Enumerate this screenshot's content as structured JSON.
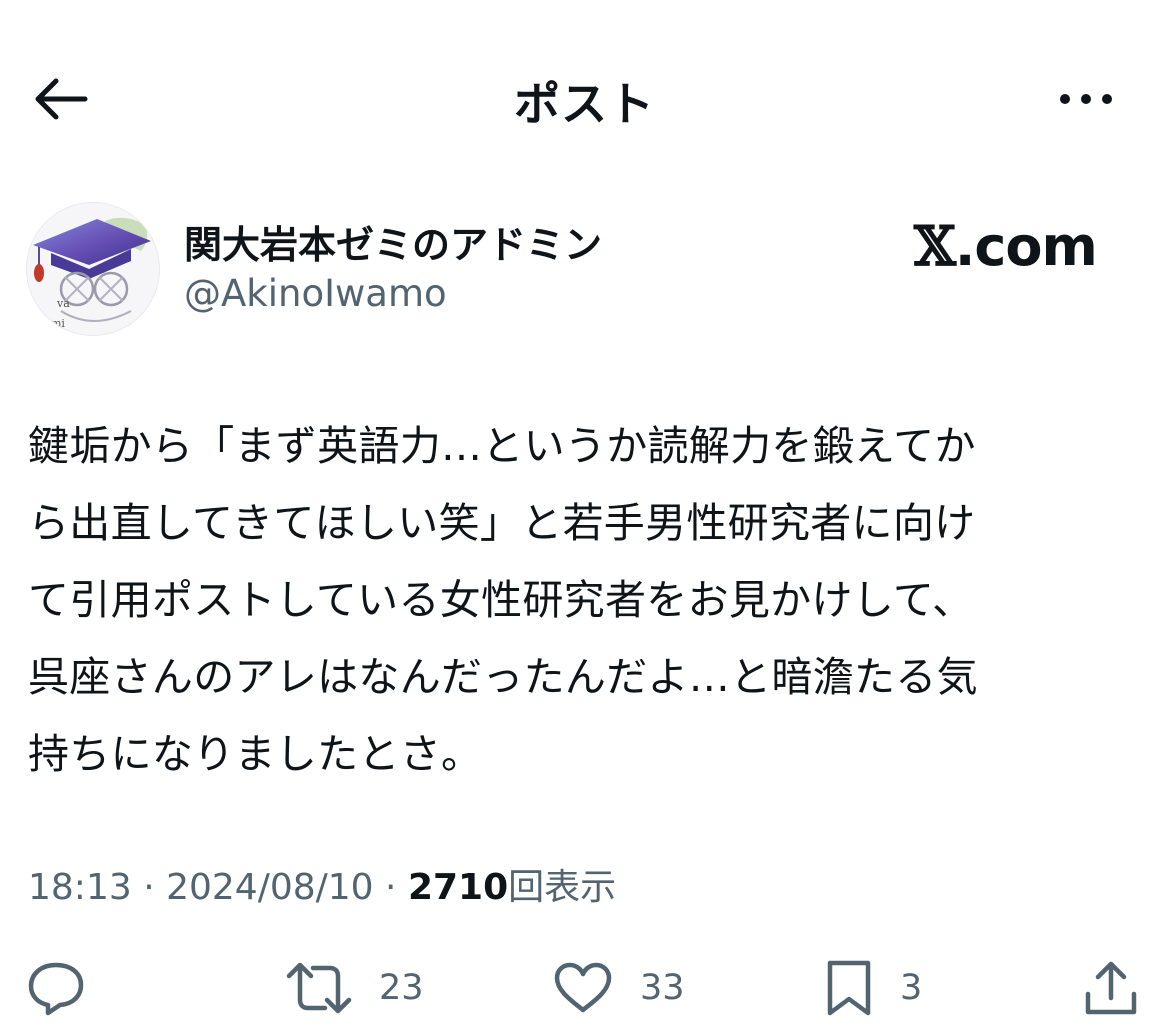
{
  "header": {
    "title": "ポスト"
  },
  "author": {
    "display_name": "関大岩本ゼミのアドミン",
    "handle": "@AkinoIwamo",
    "avatar_text_1": "va",
    "avatar_text_2": "mi"
  },
  "watermark": {
    "prefix": "𝕏",
    "suffix": ".com"
  },
  "tweet": {
    "lines": [
      "鍵垢から「まず英語力…というか読解力を鍛えてか",
      "ら出直してきてほしい笑」と若手男性研究者に向け",
      "て引用ポストしている女性研究者をお見かけして、",
      "呉座さんのアレはなんだったんだよ…と暗澹たる気",
      "持ちになりましたとさ。"
    ],
    "time": "18:13",
    "separator": " · ",
    "date": "2024/08/10",
    "views": "2710",
    "views_label": "回表示"
  },
  "actions": {
    "retweets": "23",
    "likes": "33",
    "bookmarks": "3"
  },
  "colors": {
    "text": "#0f1419",
    "muted": "#536471",
    "background": "#ffffff"
  }
}
